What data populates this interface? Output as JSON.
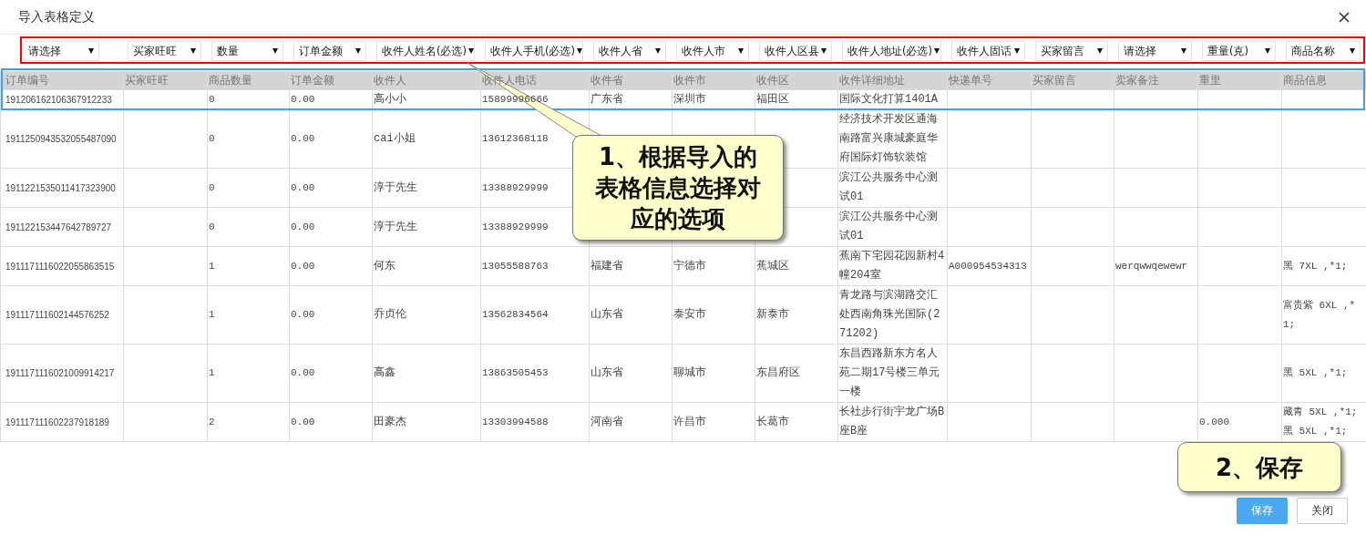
{
  "dialog": {
    "title": "导入表格定义"
  },
  "mappings": [
    {
      "label": "请选择"
    },
    {
      "label": "买家旺旺"
    },
    {
      "label": "数量"
    },
    {
      "label": "订单金额"
    },
    {
      "label": "收件人姓名(必选)"
    },
    {
      "label": "收件人手机(必选)"
    },
    {
      "label": "收件人省"
    },
    {
      "label": "收件人市"
    },
    {
      "label": "收件人区县"
    },
    {
      "label": "收件人地址(必选)"
    },
    {
      "label": "收件人固话"
    },
    {
      "label": "买家留言"
    },
    {
      "label": "请选择"
    },
    {
      "label": "重量(克)"
    },
    {
      "label": "商品名称"
    }
  ],
  "table": {
    "columns": [
      "订单编号",
      "买家旺旺",
      "商品数量",
      "订单金额",
      "收件人",
      "收件人电话",
      "收件省",
      "收件市",
      "收件区",
      "收件详细地址",
      "快递单号",
      "买家留言",
      "卖家备注",
      "重里",
      "商品信息"
    ],
    "rows": [
      [
        "191206162106367912233",
        "",
        "0",
        "0.00",
        "高小小",
        "15899996666",
        "广东省",
        "深圳市",
        "福田区",
        "国际文化打算1401A",
        "",
        "",
        "",
        "",
        ""
      ],
      [
        "1911250943532055487090",
        "",
        "0",
        "0.00",
        "cai小姐",
        "13612368118",
        "",
        "",
        "",
        "经济技术开发区通海南路富兴康城豪庭华府国际灯饰软装馆",
        "",
        "",
        "",
        "",
        ""
      ],
      [
        "1911221535011417323900",
        "",
        "0",
        "0.00",
        "淳于先生",
        "13388929999",
        "",
        "",
        "",
        "滨江公共服务中心测试01",
        "",
        "",
        "",
        "",
        ""
      ],
      [
        "191122153447642789727",
        "",
        "0",
        "0.00",
        "淳于先生",
        "13388929999",
        "",
        "",
        "",
        "滨江公共服务中心测试01",
        "",
        "",
        "",
        "",
        ""
      ],
      [
        "1911171116022055863515",
        "",
        "1",
        "0.00",
        "何东",
        "13055588763",
        "福建省",
        "宁德市",
        "蕉城区",
        "蕉南下宅园花园新村4幢204室",
        "A000954534313",
        "",
        "werqwwqewewr",
        "",
        "黑 7XL ,*1;"
      ],
      [
        "191117111602144576252",
        "",
        "1",
        "0.00",
        "乔贞伦",
        "13562834564",
        "山东省",
        "泰安市",
        "新泰市",
        "青龙路与滨湖路交汇处西南角珠光国际(271202)",
        "",
        "",
        "",
        "",
        "富贵紫 6XL ,*1;"
      ],
      [
        "1911171116021009914217",
        "",
        "1",
        "0.00",
        "高鑫",
        "13863505453",
        "山东省",
        "聊城市",
        "东昌府区",
        "东昌西路新东方名人苑二期17号楼三单元一楼",
        "",
        "",
        "",
        "",
        "黑 5XL ,*1;"
      ],
      [
        "191117111602237918189",
        "",
        "2",
        "0.00",
        "田豪杰",
        "13303994588",
        "河南省",
        "许昌市",
        "长葛市",
        "长社步行街宇龙广场B座B座",
        "",
        "",
        "",
        "0.000",
        "藏青 5XL ,*1; 黑 5XL ,*1;"
      ]
    ]
  },
  "callouts": [
    {
      "lines": [
        "1、根据导入的",
        "表格信息选择对",
        "应的选项"
      ]
    },
    {
      "lines": [
        "2、保存"
      ]
    }
  ],
  "buttons": [
    {
      "label": "保存",
      "kind": "primary"
    },
    {
      "label": "关闭",
      "kind": "default"
    }
  ]
}
